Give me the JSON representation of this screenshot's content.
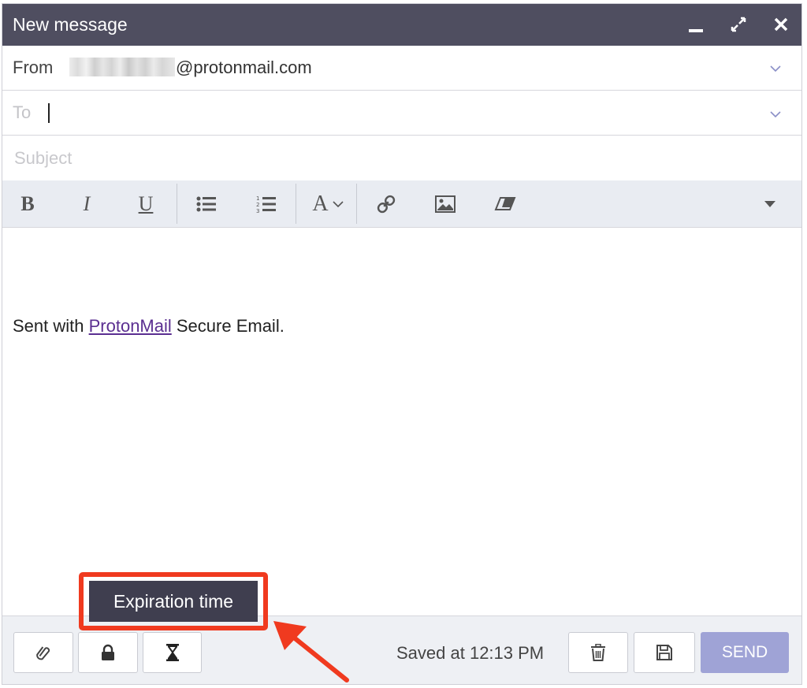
{
  "window": {
    "title": "New message"
  },
  "from": {
    "label": "From",
    "address_suffix": "@protonmail.com"
  },
  "to": {
    "placeholder": "To"
  },
  "subject": {
    "placeholder": "Subject"
  },
  "toolbar": {
    "bold": "B",
    "italic": "I",
    "underline": "U",
    "font": "A"
  },
  "body": {
    "prefix": "Sent with ",
    "link_text": "ProtonMail",
    "suffix": " Secure Email."
  },
  "tooltip": {
    "text": "Expiration time"
  },
  "footer": {
    "saved_text": "Saved at 12:13 PM",
    "send_label": "SEND"
  },
  "colors": {
    "titlebar": "#4f4e60",
    "send_button": "#9fa3d6",
    "link": "#5b2f91",
    "highlight_box": "#f03a1f",
    "arrow": "#f03a1f"
  },
  "icons": {
    "minimize": "minimize-icon",
    "maximize": "maximize-icon",
    "close": "close-icon",
    "bullet_list": "bullet-list-icon",
    "numbered_list": "numbered-list-icon",
    "link": "link-icon",
    "image": "image-icon",
    "eraser": "eraser-icon",
    "more": "caret-down-icon",
    "attachment": "paperclip-icon",
    "encryption": "lock-icon",
    "expiration": "hourglass-icon",
    "delete": "trash-icon",
    "save": "floppy-disk-icon"
  }
}
